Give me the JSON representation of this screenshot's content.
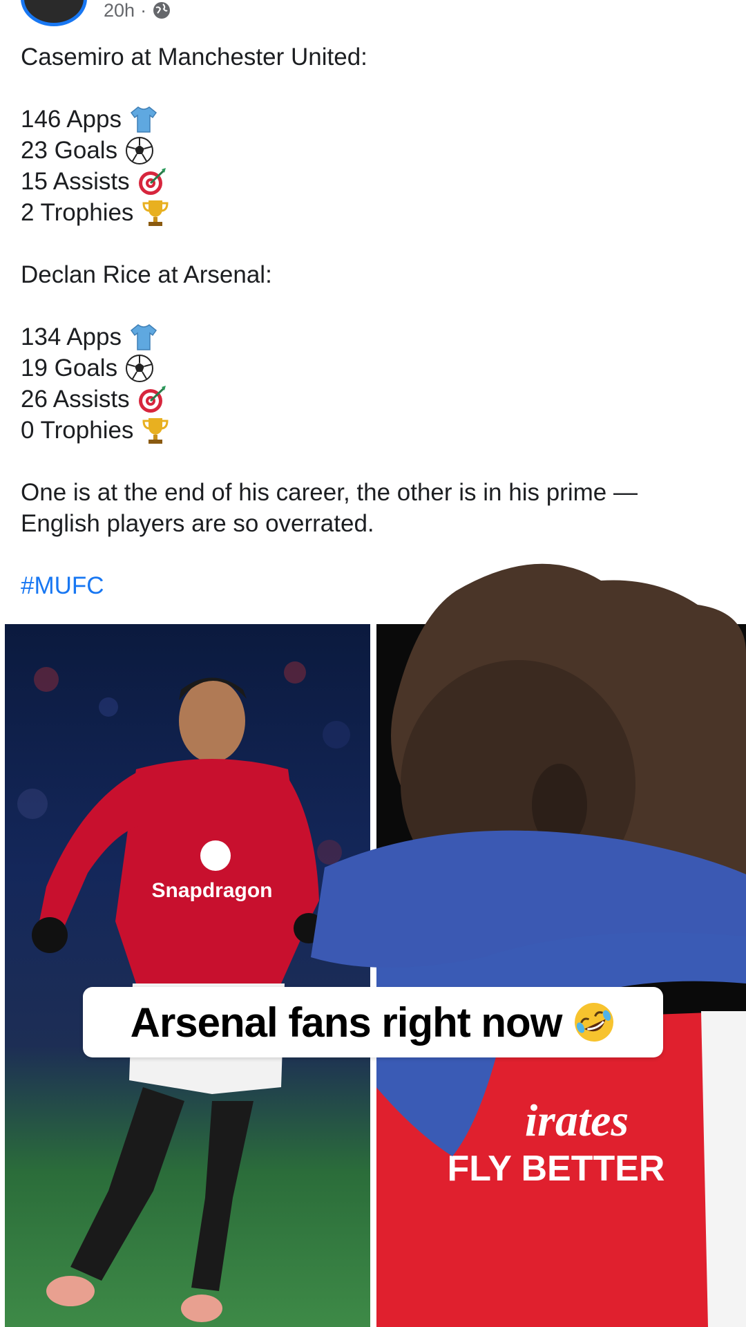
{
  "post": {
    "timestamp": "20h",
    "separator": "·",
    "privacy_icon": "globe-icon",
    "intro_casemiro": "Casemiro at Manchester United:",
    "casemiro_stats": [
      {
        "text": "146 Apps",
        "icon": "shirt-icon"
      },
      {
        "text": "23 Goals",
        "icon": "soccer-ball-icon"
      },
      {
        "text": "15 Assists",
        "icon": "target-icon"
      },
      {
        "text": "2 Trophies",
        "icon": "trophy-icon"
      }
    ],
    "intro_rice": "Declan Rice at Arsenal:",
    "rice_stats": [
      {
        "text": "134 Apps",
        "icon": "shirt-icon"
      },
      {
        "text": "19 Goals",
        "icon": "soccer-ball-icon"
      },
      {
        "text": "26 Assists",
        "icon": "target-icon"
      },
      {
        "text": "0 Trophies",
        "icon": "trophy-icon"
      }
    ],
    "conclusion_line1": "One is at the end of his career, the other is in his prime —",
    "conclusion_line2": "English players are so overrated.",
    "hashtag": "#MUFC"
  },
  "photos": {
    "left": {
      "sponsor": "Snapdragon"
    },
    "right": {
      "sponsor_line1": "irates",
      "sponsor_line2": "FLY BETTER"
    }
  },
  "overlay": {
    "caption": "Arsenal fans right now",
    "caption_emoji": "rolling-laughing-emoji"
  },
  "colors": {
    "link": "#1877f2",
    "united_red": "#c8102e",
    "arsenal_red": "#e0202e"
  }
}
